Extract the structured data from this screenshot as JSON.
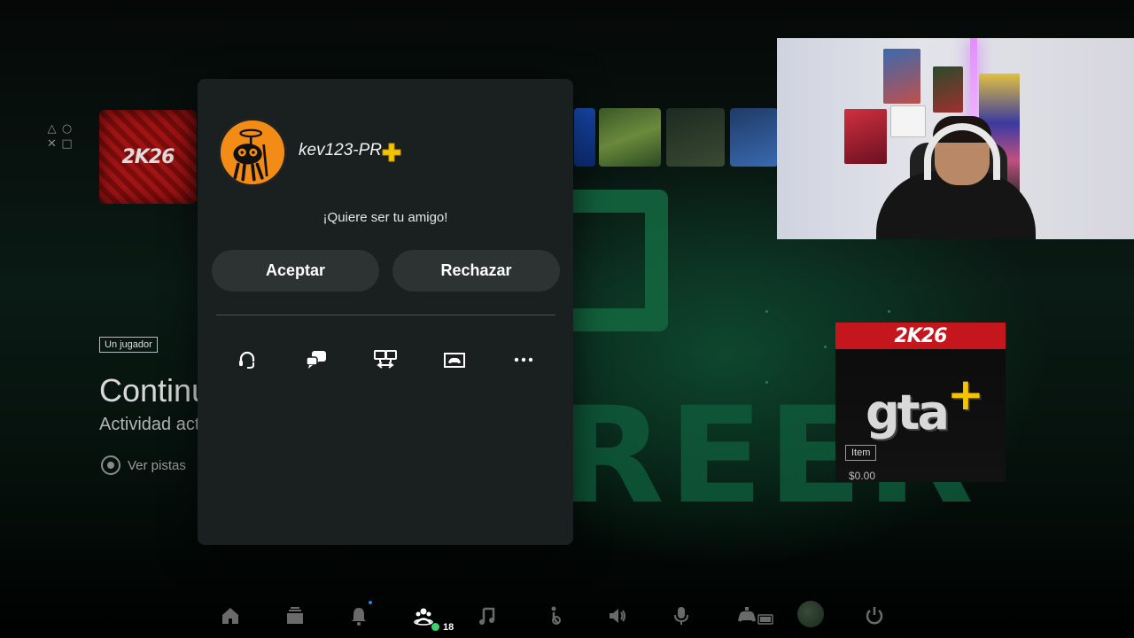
{
  "modal": {
    "username": "kev123-PR",
    "message": "¡Quiere ser tu amigo!",
    "accept_label": "Aceptar",
    "reject_label": "Rechazar",
    "actions": [
      "voice-chat-icon",
      "message-icon",
      "share-screen-icon",
      "game-library-icon",
      "more-icon"
    ]
  },
  "home": {
    "player_badge": "Un jugador",
    "continue_title": "Continu",
    "activity_subtitle": "Actividad act",
    "hint_label": "Ver pistas",
    "game_tile_logo": "2K26"
  },
  "store_card": {
    "banner_logo": "2K26",
    "gta_logo": "gta",
    "item_badge": "Item",
    "price": "$0.00"
  },
  "control_center": {
    "friends_online_count": "18",
    "items": [
      "home-icon",
      "game-library-icon",
      "notifications-icon",
      "game-base-icon",
      "music-icon",
      "accessibility-icon",
      "sound-icon",
      "mic-icon",
      "controller-icon",
      "profile-avatar",
      "power-icon"
    ]
  },
  "colors": {
    "modal_bg": "#1a1f1f",
    "button_bg": "#2c3332",
    "online_green": "#3ad36c",
    "plus_gold": "#f4c400",
    "avatar_orange": "#f28c16"
  }
}
